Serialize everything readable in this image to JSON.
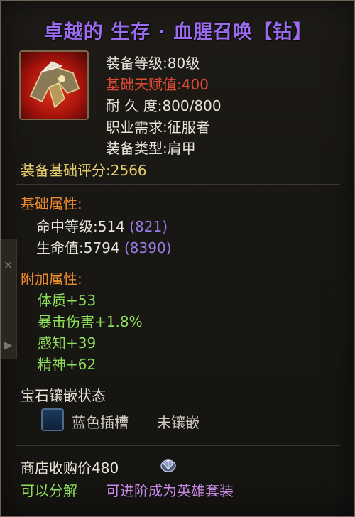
{
  "item": {
    "title": "卓越的 生存 · 血腥召唤【钻】",
    "icon": "shoulder-armor-icon"
  },
  "stats": {
    "level_label": "装备等级:",
    "level_value": "80级",
    "talent_label": "基础天赋值:",
    "talent_value": "400",
    "durability_label": "耐 久 度:",
    "durability_value": "800/800",
    "class_label": "职业需求:",
    "class_value": "征服者",
    "type_label": "装备类型:",
    "type_value": "肩甲",
    "score_label": "装备基础评分:",
    "score_value": "2566"
  },
  "base_attributes": {
    "header": "基础属性:",
    "items": [
      {
        "label": "命中等级:514",
        "bonus": "(821)"
      },
      {
        "label": "生命值:5794",
        "bonus": "(8390)"
      }
    ]
  },
  "extra_attributes": {
    "header": "附加属性:",
    "items": [
      "体质+53",
      "暴击伤害+1.8%",
      "感知+39",
      "精神+62"
    ]
  },
  "gems": {
    "header": "宝石镶嵌状态",
    "socket_label": "蓝色插槽",
    "socket_state": "未镶嵌"
  },
  "footer": {
    "sell_price": "商店收购价480",
    "decompose": "可以分解",
    "upgrade": "可进阶成为英雄套装"
  },
  "colors": {
    "title": "#9b6cf0",
    "talent": "#e04a33",
    "score": "#e6cf6a",
    "header": "#ee8a2c",
    "extra": "#8fe05a",
    "bonus": "#9c7ae8"
  }
}
